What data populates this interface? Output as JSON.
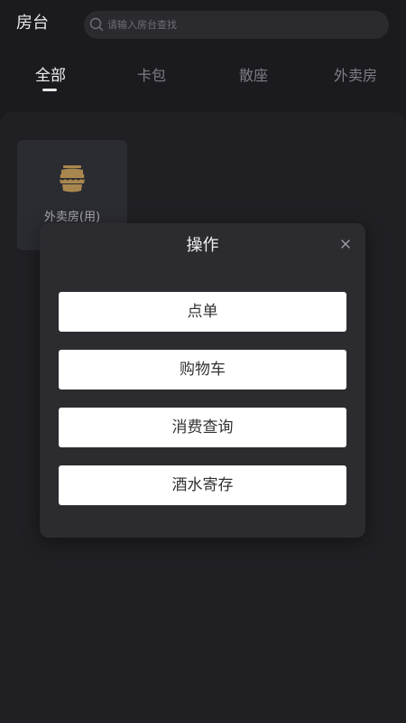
{
  "header": {
    "title": "房台",
    "search_placeholder": "请输入房台查找"
  },
  "tabs": [
    {
      "label": "全部",
      "active": true
    },
    {
      "label": "卡包",
      "active": false
    },
    {
      "label": "散座",
      "active": false
    },
    {
      "label": "外卖房",
      "active": false
    }
  ],
  "rooms": [
    {
      "name": "外卖房(用)",
      "icon": "food-jar-icon"
    }
  ],
  "modal": {
    "title": "操作",
    "close_icon": "close-icon",
    "actions": [
      {
        "label": "点单"
      },
      {
        "label": "购物车"
      },
      {
        "label": "消费查询"
      },
      {
        "label": "酒水寄存"
      }
    ]
  },
  "colors": {
    "background": "#1b1b1f",
    "panel": "#1f1f24",
    "card": "#2b2c31",
    "modal": "#2b2b30",
    "button": "#ffffff",
    "room_icon": "#a8874e"
  }
}
